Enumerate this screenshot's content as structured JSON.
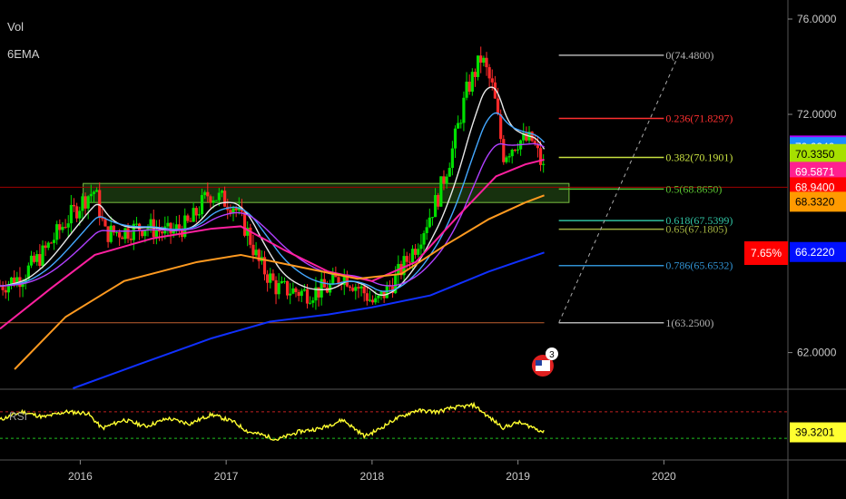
{
  "indicators": {
    "volume": "Vol",
    "ema": "6EMA",
    "rsi": "RSI"
  },
  "colors": {
    "bull": "#00e000",
    "bear": "#ff2a2a",
    "ema_white": "#e8e8e8",
    "ema_cyan": "#44a8ff",
    "ema_purple": "#b040ff",
    "ema_magenta": "#ff20a0",
    "ema_orange": "#ff9a20",
    "ema_blue": "#1030ff",
    "zone": "#2a5a1a",
    "rsi": "#ffff30"
  },
  "chart_data": {
    "type": "line",
    "title": "",
    "x_ticks": [
      "2016",
      "2017",
      "2018",
      "2019",
      "2020"
    ],
    "y_ticks": [
      "76.0000",
      "72.0000",
      "62.0000"
    ],
    "ylim": [
      60.5,
      76.8
    ],
    "price_path": [
      {
        "x": 2015.45,
        "y": 64.8
      },
      {
        "x": 2015.6,
        "y": 65.2
      },
      {
        "x": 2015.75,
        "y": 66.2
      },
      {
        "x": 2015.9,
        "y": 67.5
      },
      {
        "x": 2016.05,
        "y": 68.6
      },
      {
        "x": 2016.1,
        "y": 68.8
      },
      {
        "x": 2016.17,
        "y": 67.0
      },
      {
        "x": 2016.3,
        "y": 67.1
      },
      {
        "x": 2016.45,
        "y": 67.3
      },
      {
        "x": 2016.6,
        "y": 67.0
      },
      {
        "x": 2016.75,
        "y": 67.4
      },
      {
        "x": 2016.88,
        "y": 68.7
      },
      {
        "x": 2017.05,
        "y": 68.2
      },
      {
        "x": 2017.15,
        "y": 67.0
      },
      {
        "x": 2017.22,
        "y": 65.8
      },
      {
        "x": 2017.35,
        "y": 64.7
      },
      {
        "x": 2017.55,
        "y": 64.5
      },
      {
        "x": 2017.7,
        "y": 64.7
      },
      {
        "x": 2017.8,
        "y": 65.3
      },
      {
        "x": 2017.95,
        "y": 64.5
      },
      {
        "x": 2018.02,
        "y": 64.0
      },
      {
        "x": 2018.15,
        "y": 65.0
      },
      {
        "x": 2018.3,
        "y": 66.5
      },
      {
        "x": 2018.45,
        "y": 68.5
      },
      {
        "x": 2018.55,
        "y": 70.5
      },
      {
        "x": 2018.65,
        "y": 73.0
      },
      {
        "x": 2018.75,
        "y": 74.4
      },
      {
        "x": 2018.83,
        "y": 73.0
      },
      {
        "x": 2018.9,
        "y": 70.3
      },
      {
        "x": 2019.0,
        "y": 70.9
      },
      {
        "x": 2019.1,
        "y": 70.9
      },
      {
        "x": 2019.18,
        "y": 69.6
      }
    ],
    "ema_lines": [
      {
        "name": "",
        "color": "#ff20a0",
        "points": [
          {
            "x": 2015.45,
            "y": 63.0
          },
          {
            "x": 2015.8,
            "y": 64.7
          },
          {
            "x": 2016.1,
            "y": 66.1
          },
          {
            "x": 2016.5,
            "y": 66.8
          },
          {
            "x": 2016.9,
            "y": 67.2
          },
          {
            "x": 2017.1,
            "y": 67.3
          },
          {
            "x": 2017.4,
            "y": 66.3
          },
          {
            "x": 2017.7,
            "y": 65.4
          },
          {
            "x": 2018.0,
            "y": 65.0
          },
          {
            "x": 2018.3,
            "y": 65.8
          },
          {
            "x": 2018.6,
            "y": 67.8
          },
          {
            "x": 2018.85,
            "y": 69.4
          },
          {
            "x": 2019.05,
            "y": 69.9
          },
          {
            "x": 2019.18,
            "y": 70.1
          }
        ]
      },
      {
        "name": "",
        "color": "#ff9a20",
        "points": [
          {
            "x": 2015.55,
            "y": 61.3
          },
          {
            "x": 2015.9,
            "y": 63.5
          },
          {
            "x": 2016.3,
            "y": 65.0
          },
          {
            "x": 2016.8,
            "y": 65.8
          },
          {
            "x": 2017.1,
            "y": 66.1
          },
          {
            "x": 2017.5,
            "y": 65.6
          },
          {
            "x": 2017.9,
            "y": 65.1
          },
          {
            "x": 2018.2,
            "y": 65.3
          },
          {
            "x": 2018.5,
            "y": 66.5
          },
          {
            "x": 2018.8,
            "y": 67.6
          },
          {
            "x": 2019.05,
            "y": 68.3
          },
          {
            "x": 2019.18,
            "y": 68.6
          }
        ]
      },
      {
        "name": "",
        "color": "#1030ff",
        "points": [
          {
            "x": 2015.95,
            "y": 60.5
          },
          {
            "x": 2016.4,
            "y": 61.5
          },
          {
            "x": 2016.9,
            "y": 62.6
          },
          {
            "x": 2017.3,
            "y": 63.3
          },
          {
            "x": 2017.7,
            "y": 63.6
          },
          {
            "x": 2018.0,
            "y": 63.9
          },
          {
            "x": 2018.4,
            "y": 64.4
          },
          {
            "x": 2018.8,
            "y": 65.4
          },
          {
            "x": 2019.18,
            "y": 66.2
          }
        ]
      }
    ],
    "support_zone": {
      "x_start": 2016.02,
      "x_end": 2019.35,
      "y_low": 68.3,
      "y_high": 69.1
    },
    "horizontal_lines": [
      {
        "y": 68.94,
        "color": "#a00000",
        "style": "solid"
      },
      {
        "y": 63.25,
        "color": "#c06030",
        "style": "solid"
      }
    ],
    "fibonacci": [
      {
        "label": "0(74.4800)",
        "level": 74.48,
        "color": "#b0b0b0"
      },
      {
        "label": "0.236(71.8297)",
        "level": 71.8297,
        "color": "#ff3030"
      },
      {
        "label": "0.382(70.1901)",
        "level": 70.1901,
        "color": "#c8e040"
      },
      {
        "label": "0.5(68.8650)",
        "level": 68.865,
        "color": "#58c030"
      },
      {
        "label": "0.618(67.5399)",
        "level": 67.5399,
        "color": "#30c0a0"
      },
      {
        "label": "0.65(67.1805)",
        "level": 67.1805,
        "color": "#a0b040"
      },
      {
        "label": "0.786(65.6532)",
        "level": 65.6532,
        "color": "#3090d0"
      },
      {
        "label": "1(63.2500)",
        "level": 63.25,
        "color": "#b0b0b0"
      }
    ],
    "fib_x_range": [
      2019.28,
      2020.0
    ],
    "price_badges": [
      {
        "label": "70.6917",
        "value": 70.6917,
        "bg": "#b000ff",
        "fg": "#ffffff"
      },
      {
        "label": "70.6240",
        "value": 70.624,
        "bg": "#1a8cff",
        "fg": "#ffffff"
      },
      {
        "label": "70.3350",
        "value": 70.335,
        "bg": "#a6e000",
        "fg": "#000000"
      },
      {
        "label": "69.5871",
        "value": 69.5871,
        "bg": "#ff2090",
        "fg": "#ffffff"
      },
      {
        "label": "68.9400",
        "value": 68.94,
        "bg": "#ff0000",
        "fg": "#ffffff"
      },
      {
        "label": "68.3320",
        "value": 68.332,
        "bg": "#ff9a00",
        "fg": "#000000"
      },
      {
        "label": "66.2220",
        "value": 66.222,
        "bg": "#0010ff",
        "fg": "#ffffff"
      }
    ],
    "percent_label": "7.65%",
    "event_marker": {
      "count": "3",
      "x": 2019.17
    },
    "rsi": {
      "label": "RSI",
      "value_label": "39.3201",
      "upper": 70,
      "lower": 30,
      "points": [
        {
          "x": 2015.45,
          "y": 58
        },
        {
          "x": 2015.6,
          "y": 70
        },
        {
          "x": 2015.75,
          "y": 62
        },
        {
          "x": 2015.9,
          "y": 70
        },
        {
          "x": 2016.05,
          "y": 68
        },
        {
          "x": 2016.15,
          "y": 45
        },
        {
          "x": 2016.3,
          "y": 58
        },
        {
          "x": 2016.45,
          "y": 48
        },
        {
          "x": 2016.6,
          "y": 60
        },
        {
          "x": 2016.75,
          "y": 52
        },
        {
          "x": 2016.9,
          "y": 66
        },
        {
          "x": 2017.05,
          "y": 55
        },
        {
          "x": 2017.15,
          "y": 40
        },
        {
          "x": 2017.25,
          "y": 35
        },
        {
          "x": 2017.35,
          "y": 28
        },
        {
          "x": 2017.5,
          "y": 40
        },
        {
          "x": 2017.65,
          "y": 45
        },
        {
          "x": 2017.8,
          "y": 58
        },
        {
          "x": 2017.95,
          "y": 33
        },
        {
          "x": 2018.05,
          "y": 44
        },
        {
          "x": 2018.15,
          "y": 58
        },
        {
          "x": 2018.3,
          "y": 72
        },
        {
          "x": 2018.45,
          "y": 70
        },
        {
          "x": 2018.55,
          "y": 76
        },
        {
          "x": 2018.7,
          "y": 80
        },
        {
          "x": 2018.8,
          "y": 62
        },
        {
          "x": 2018.9,
          "y": 46
        },
        {
          "x": 2019.0,
          "y": 54
        },
        {
          "x": 2019.1,
          "y": 47
        },
        {
          "x": 2019.18,
          "y": 39
        }
      ]
    }
  }
}
